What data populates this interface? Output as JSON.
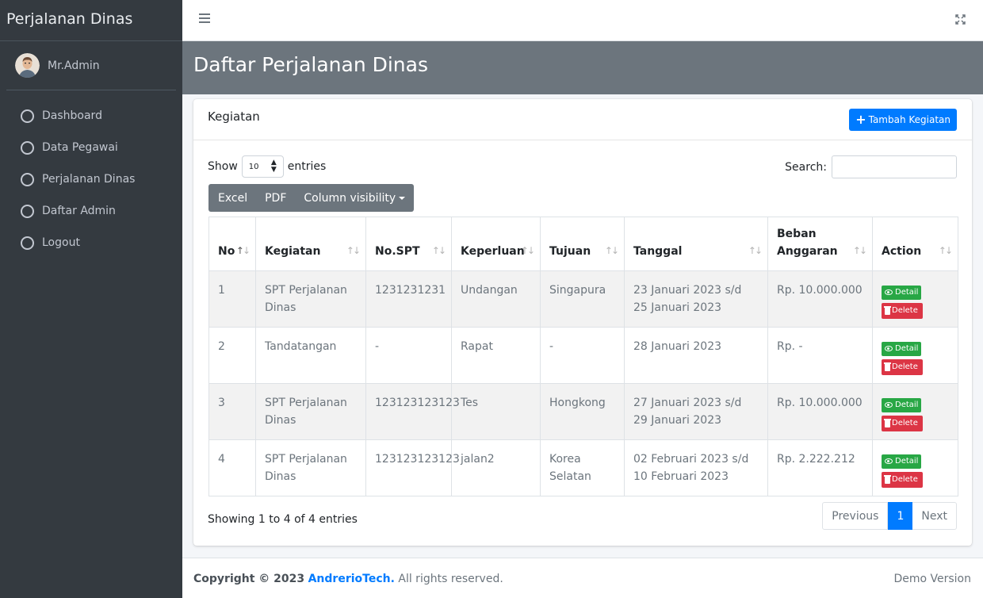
{
  "sidebar": {
    "brand": "Perjalanan Dinas",
    "user": "Mr.Admin",
    "items": [
      {
        "label": "Dashboard"
      },
      {
        "label": "Data Pegawai"
      },
      {
        "label": "Perjalanan Dinas"
      },
      {
        "label": "Daftar Admin"
      },
      {
        "label": "Logout"
      }
    ]
  },
  "header": {
    "title": "Daftar Perjalanan Dinas"
  },
  "card": {
    "title": "Kegiatan",
    "add_button": "Tambah Kegiatan",
    "show_label": "Show",
    "entries_value": "10",
    "entries_label": "entries",
    "search_label": "Search:",
    "search_value": "",
    "buttons": {
      "excel": "Excel",
      "pdf": "PDF",
      "colvis": "Column visibility"
    }
  },
  "table": {
    "columns": [
      "No",
      "Kegiatan",
      "No.SPT",
      "Keperluan",
      "Tujuan",
      "Tanggal",
      "Beban Anggaran",
      "Action"
    ],
    "rows": [
      {
        "no": "1",
        "kegiatan": "SPT Perjalanan Dinas",
        "spt": "1231231231",
        "keperluan": "Undangan",
        "tujuan": "Singapura",
        "tanggal": "23 Januari 2023 s/d 25 Januari 2023",
        "anggaran": "Rp. 10.000.000"
      },
      {
        "no": "2",
        "kegiatan": "Tandatangan",
        "spt": "-",
        "keperluan": "Rapat",
        "tujuan": "-",
        "tanggal": "28 Januari 2023",
        "anggaran": "Rp. -"
      },
      {
        "no": "3",
        "kegiatan": "SPT Perjalanan Dinas",
        "spt": "123123123123",
        "keperluan": "Tes",
        "tujuan": "Hongkong",
        "tanggal": "27 Januari 2023 s/d 29 Januari 2023",
        "anggaran": "Rp. 10.000.000"
      },
      {
        "no": "4",
        "kegiatan": "SPT Perjalanan Dinas",
        "spt": "123123123123",
        "keperluan": "jalan2",
        "tujuan": "Korea Selatan",
        "tanggal": "02 Februari 2023 s/d 10 Februari 2023",
        "anggaran": "Rp. 2.222.212"
      }
    ],
    "detail_label": "Detail",
    "delete_label": "Delete"
  },
  "pagination": {
    "info": "Showing 1 to 4 of 4 entries",
    "previous": "Previous",
    "current": "1",
    "next": "Next"
  },
  "footer": {
    "copyright": "Copyright © 2023",
    "brand": "AndrerioTech.",
    "rights": "All rights reserved.",
    "version": "Demo Version"
  },
  "colors": {
    "sidebar": "#343a40",
    "primary": "#007bff",
    "success": "#28a745",
    "danger": "#dc3545",
    "header": "#6c757d"
  }
}
